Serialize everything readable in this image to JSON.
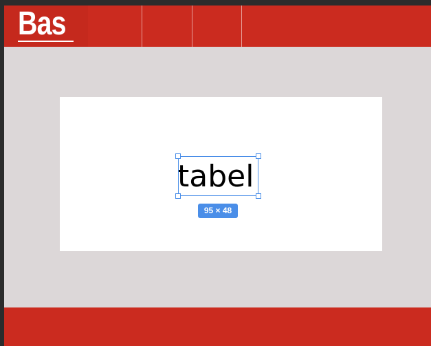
{
  "header": {
    "logo_text": "Bas"
  },
  "canvas": {
    "text_layer": {
      "content": "tabel"
    },
    "selection": {
      "size_label": "95 × 48"
    }
  },
  "colors": {
    "brand_red": "#cb2b1f",
    "frame_background": "#dcd7d8",
    "selection_blue": "#4a8ee8",
    "card_background": "#ffffff"
  }
}
